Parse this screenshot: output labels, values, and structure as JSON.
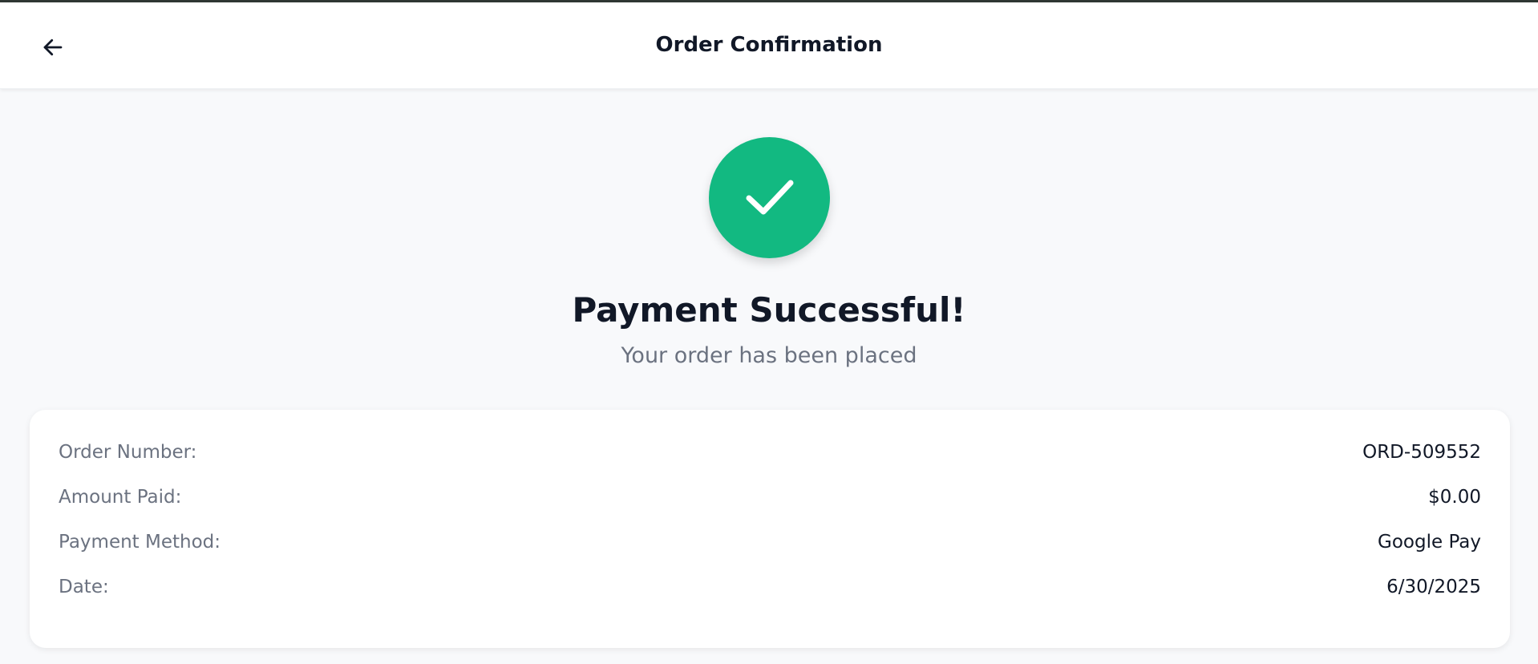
{
  "header": {
    "title": "Order Confirmation",
    "back_icon": "arrow-left-icon"
  },
  "status": {
    "icon": "checkmark-icon",
    "icon_bg_color": "#12b981",
    "headline": "Payment Successful!",
    "subline": "Your order has been placed"
  },
  "order_details": {
    "rows": [
      {
        "label": "Order Number:",
        "value": "ORD-509552"
      },
      {
        "label": "Amount Paid:",
        "value": "$0.00"
      },
      {
        "label": "Payment Method:",
        "value": "Google Pay"
      },
      {
        "label": "Date:",
        "value": "6/30/2025"
      }
    ]
  }
}
